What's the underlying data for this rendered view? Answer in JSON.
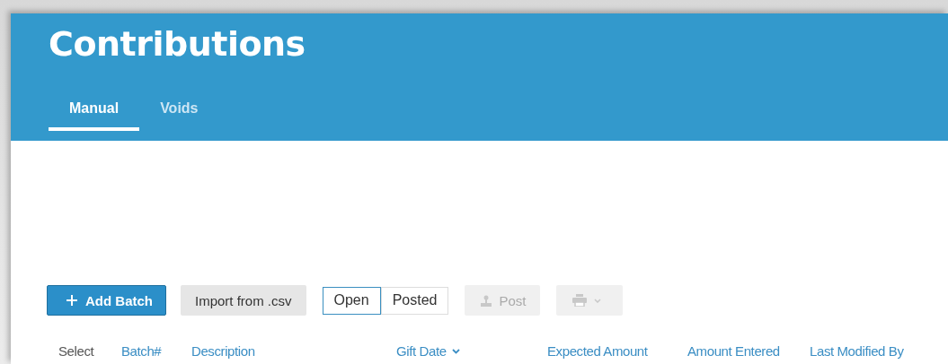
{
  "header": {
    "title": "Contributions"
  },
  "tabs": [
    {
      "label": "Manual",
      "selected": true
    },
    {
      "label": "Voids",
      "selected": false
    }
  ],
  "toolbar": [
    {
      "kind": "primary",
      "label": "Add Batch"
    },
    {
      "kind": "secondary",
      "label": "Import from .csv"
    },
    {
      "kind": "toggle",
      "options": [
        {
          "label": "Open",
          "selected": true
        },
        {
          "label": "Posted",
          "selected": false
        }
      ]
    },
    {
      "kind": "post",
      "label": "Post",
      "disabled": true
    },
    {
      "kind": "print",
      "disabled": true
    }
  ],
  "table": {
    "columns": [
      {
        "label": "Select",
        "sortable": false,
        "sorted": false
      },
      {
        "label": "Batch#",
        "sortable": true,
        "sorted": false
      },
      {
        "label": "Description",
        "sortable": true,
        "sorted": false
      },
      {
        "label": "Gift Date",
        "sortable": true,
        "sorted": true
      },
      {
        "label": "Expected Amount",
        "sortable": true,
        "sorted": false
      },
      {
        "label": "Amount Entered",
        "sortable": true,
        "sorted": false
      },
      {
        "label": "Last Modified By",
        "sortable": true,
        "sorted": false
      }
    ]
  }
}
